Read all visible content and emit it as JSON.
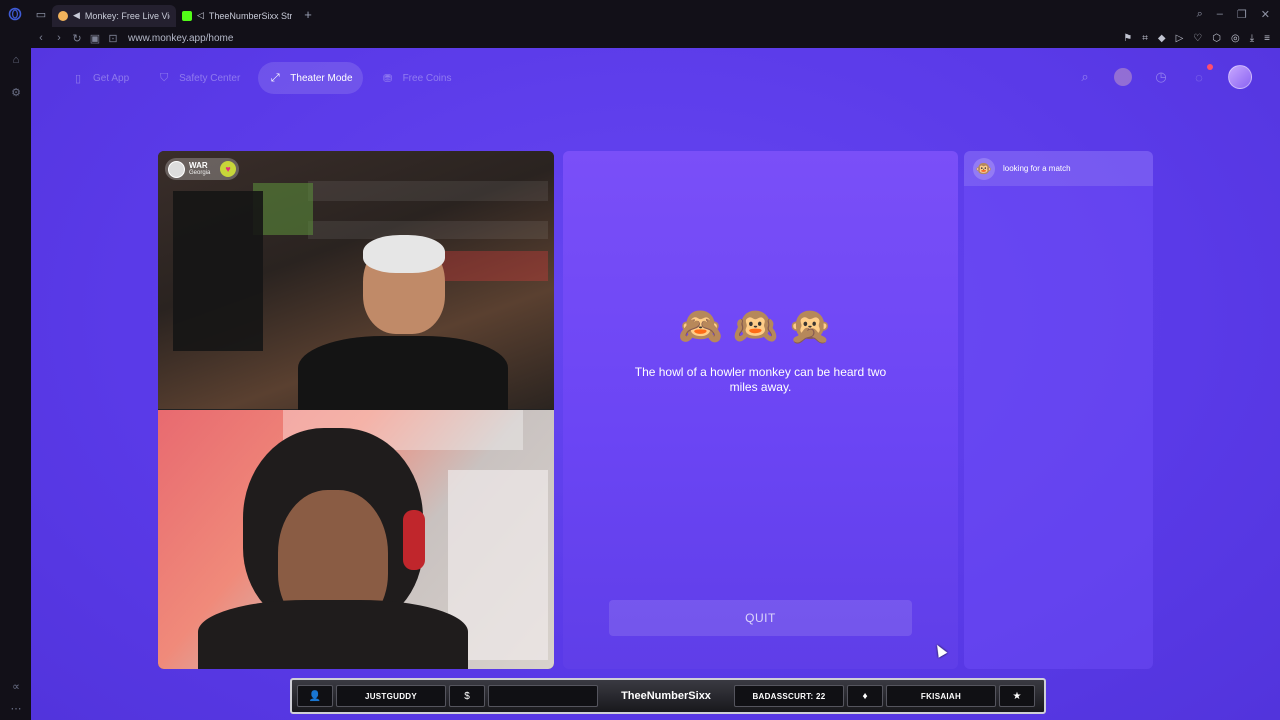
{
  "browser": {
    "tabs": [
      {
        "label": "Monkey: Free Live Vide",
        "active": true
      },
      {
        "label": "TheeNumberSixx Strea",
        "active": false
      }
    ],
    "url": "www.monkey.app/home"
  },
  "nav": {
    "items": [
      {
        "label": "Get App",
        "icon": "phone-icon",
        "active": false
      },
      {
        "label": "Safety Center",
        "icon": "shield-icon",
        "active": false
      },
      {
        "label": "Theater Mode",
        "icon": "expand-icon",
        "active": true
      },
      {
        "label": "Free Coins",
        "icon": "coins-icon",
        "active": false
      }
    ]
  },
  "video": {
    "top_user": {
      "name": "WAR",
      "location": "Georgia"
    }
  },
  "match": {
    "emojis": "🙈🙉🙊",
    "fact": "The howl of a howler monkey can be heard two miles away.",
    "quit_label": "QUIT"
  },
  "chat": {
    "status": "looking for a match"
  },
  "overlay": {
    "follower": "JUSTGUDDY",
    "donation": "",
    "streamer": "TheeNumberSixx",
    "sub": "BADASSCURT: 22",
    "star": "FKISAIAH"
  },
  "colors": {
    "page_bg": "#5a3ae8",
    "card": "#6b45f4",
    "accent": "#7a4ff8"
  }
}
